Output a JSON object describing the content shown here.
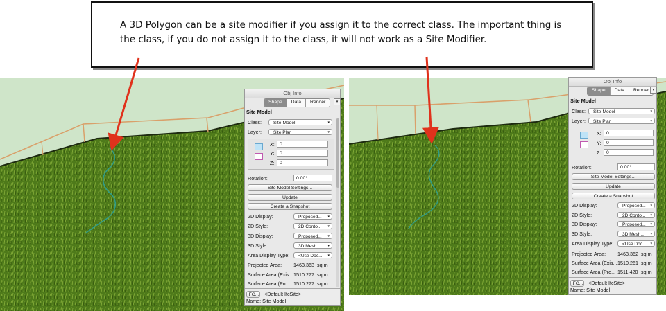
{
  "callout": {
    "line1": "A 3D Polygon can be a site modifier if you assign it to the correct class. The important thing is",
    "line2": "the class, if you do not assign it to the class, it will not work as a Site Modifier."
  },
  "panels": [
    {
      "title": "Obj Info",
      "tabs": [
        "Shape",
        "Data",
        "Render"
      ],
      "section": "Site Model",
      "class_label": "Class:",
      "class_value": "Site-Model",
      "layer_label": "Layer:",
      "layer_value": "Site Plan",
      "x_label": "X:",
      "x_value": "0",
      "y_label": "Y:",
      "y_value": "0",
      "z_label": "Z:",
      "z_value": "0",
      "rotation_label": "Rotation:",
      "rotation_value": "0.00°",
      "btn_settings": "Site Model Settings...",
      "btn_update": "Update",
      "btn_snapshot": "Create a Snapshot",
      "d2_display_label": "2D Display:",
      "d2_display_value": "Proposed...",
      "d2_style_label": "2D Style:",
      "d2_style_value": "2D Conto...",
      "d3_display_label": "3D Display:",
      "d3_display_value": "Proposed...",
      "d3_style_label": "3D Style:",
      "d3_style_value": "3D Mesh...",
      "area_type_label": "Area Display Type:",
      "area_type_value": "<Use Doc...",
      "proj_area_label": "Projected Area:",
      "proj_area_value": "1463.363",
      "proj_area_unit": "sq m",
      "surf_exist_label": "Surface Area (Exis...",
      "surf_exist_value": "1510.277",
      "surf_exist_unit": "sq m",
      "surf_prop_label": "Surface Area (Pro...",
      "surf_prop_value": "1510.277",
      "surf_prop_unit": "sq m",
      "ifc_button": "IFC...",
      "ifc_value": "<Default IfcSite>",
      "name_line": "Name: Site Model"
    },
    {
      "title": "Obj Info",
      "tabs": [
        "Shape",
        "Data",
        "Render"
      ],
      "section": "Site Model",
      "class_label": "Class:",
      "class_value": "Site-Model",
      "layer_label": "Layer:",
      "layer_value": "Site Plan",
      "x_label": "X:",
      "x_value": "0",
      "y_label": "Y:",
      "y_value": "0",
      "z_label": "Z:",
      "z_value": "0",
      "rotation_label": "Rotation:",
      "rotation_value": "0.00°",
      "btn_settings": "Site Model Settings...",
      "btn_update": "Update",
      "btn_snapshot": "Create a Snapshot",
      "d2_display_label": "2D Display:",
      "d2_display_value": "Proposed...",
      "d2_style_label": "2D Style:",
      "d2_style_value": "2D Conto...",
      "d3_display_label": "3D Display:",
      "d3_display_value": "Proposed...",
      "d3_style_label": "3D Style:",
      "d3_style_value": "3D Mesh...",
      "area_type_label": "Area Display Type:",
      "area_type_value": "<Use Doc...",
      "proj_area_label": "Projected Area:",
      "proj_area_value": "1463.362",
      "proj_area_unit": "sq m",
      "surf_exist_label": "Surface Area (Exis...",
      "surf_exist_value": "1510.261",
      "surf_exist_unit": "sq m",
      "surf_prop_label": "Surface Area (Pro...",
      "surf_prop_value": "1511.420",
      "surf_prop_unit": "sq m",
      "ifc_button": "IFC...",
      "ifc_value": "<Default IfcSite>",
      "name_line": "Name: Site Model"
    }
  ],
  "colors": {
    "sky": "#cfe5c9",
    "grass_dark": "#3f6a12",
    "grass_light": "#6f9a2a",
    "fence": "#d9a06a",
    "contour": "#2f9c8a",
    "arrow": "#e0321c"
  }
}
